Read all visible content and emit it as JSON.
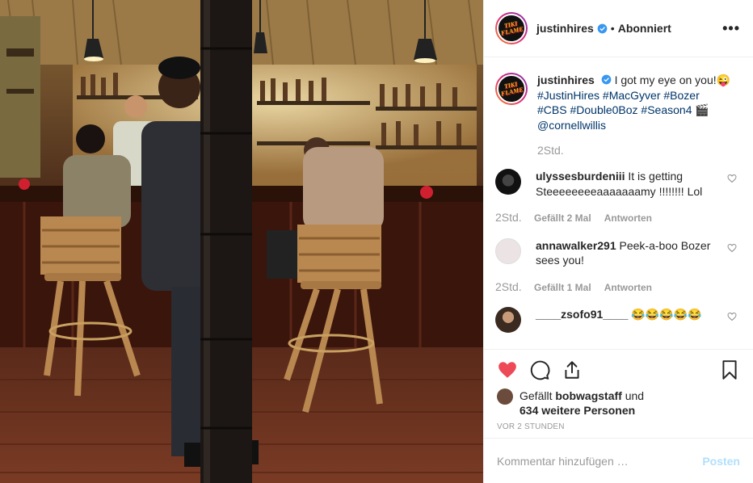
{
  "header": {
    "username": "justinhires",
    "separator": "•",
    "follow_status": "Abonniert",
    "more": "•••",
    "logo_text": "TIKI FLAME"
  },
  "caption": {
    "username": "justinhires",
    "text": "I got my eye on you!😜",
    "hashtags": [
      "#JustinHires",
      "#MacGyver",
      "#Bozer",
      "#CBS",
      "#Double0Boz",
      "#Season4",
      "🎬"
    ],
    "mention": "@cornellwillis",
    "time": "2Std."
  },
  "comments": [
    {
      "username": "ulyssesburdeniii",
      "text": "It is getting Steeeeeeeeaaaaaaamy !!!!!!!! Lol",
      "time": "2Std.",
      "likes": "",
      "reply": "Antworten"
    },
    {
      "username": "annawalker291",
      "text": "Peek-a-boo Bozer sees you!",
      "time": "2Std.",
      "likes": "Gefällt 2 Mal",
      "reply": "Antworten"
    },
    {
      "username": "____zsofo91____",
      "text": "😂😂😂😂😂",
      "time": "2Std.",
      "likes": "Gefällt 1 Mal",
      "reply": "Antworten"
    }
  ],
  "first_comment_meta": {
    "time": "2Std.",
    "likes": "Gefällt 2 Mal",
    "reply": "Antworten"
  },
  "second_comment_meta": {
    "time": "2Std.",
    "likes": "Gefällt 1 Mal",
    "reply": "Antworten"
  },
  "likes": {
    "prefix": "Gefällt",
    "user": "bobwagstaff",
    "connector": "und",
    "others": "634 weitere Personen"
  },
  "posted_ago": "VOR 2 STUNDEN",
  "add_comment": {
    "placeholder": "Kommentar hinzufügen …",
    "post_label": "Posten"
  },
  "colors": {
    "like_red": "#ed4956",
    "link_blue": "#003569",
    "verified_blue": "#3897f0",
    "post_disabled": "#b2dffc"
  },
  "icons": [
    "heart-icon",
    "comment-icon",
    "share-icon",
    "bookmark-icon",
    "verified-badge-icon",
    "more-options-icon",
    "comment-like-icon"
  ]
}
